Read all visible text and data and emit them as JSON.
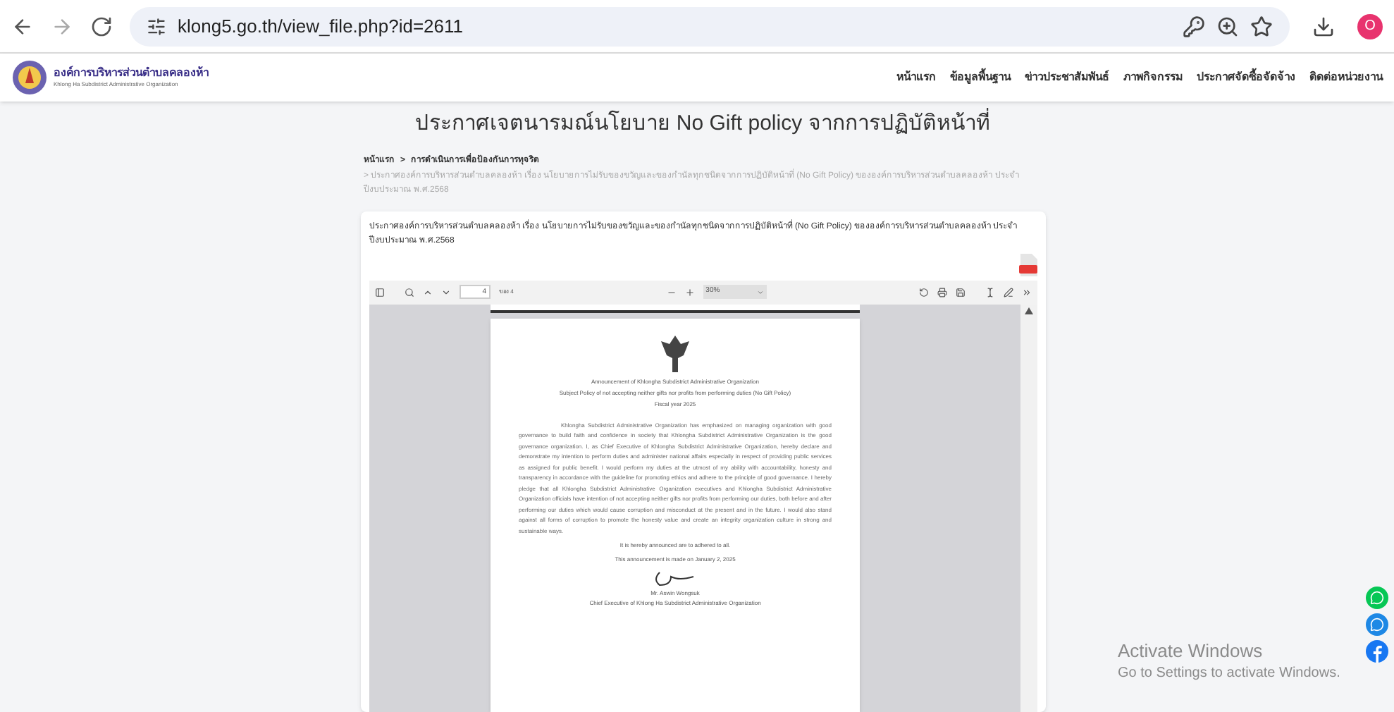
{
  "browser": {
    "url": "klong5.go.th/view_file.php?id=2611",
    "profile_initial": "O"
  },
  "site": {
    "name": "องค์การบริหารส่วนตำบลคลองห้า",
    "subtitle": "Khlong Ha Subdistrict Administrative Organization",
    "nav": [
      "หน้าแรก",
      "ข้อมูลพื้นฐาน",
      "ข่าวประชาสัมพันธ์",
      "ภาพกิจกรรม",
      "ประกาศจัดซื้อจัดจ้าง",
      "ติดต่อหน่วยงาน"
    ]
  },
  "page": {
    "title": "ประกาศเจตนารมณ์นโยบาย No Gift policy จากการปฏิบัติหน้าที่",
    "breadcrumb": [
      "หน้าแรก",
      "การดำเนินการเพื่อป้องกันการทุจริต"
    ],
    "breadcrumb_separator": ">",
    "breadcrumb_current": "> ประกาศองค์การบริหารส่วนตำบลคลองห้า เรื่อง นโยบายการไม่รับของขวัญและของกำนัลทุกชนิดจากการปฏิบัติหน้าที่ (No Gift Policy) ขององค์การบริหารส่วนตำบลคลองห้า ประจำปีงบประมาณ พ.ศ.2568",
    "file_title": "ประกาศองค์การบริหารส่วนตำบลคลองห้า เรื่อง นโยบายการไม่รับของขวัญและของกำนัลทุกชนิดจากการปฏิบัติหน้าที่ (No Gift Policy) ขององค์การบริหารส่วนตำบลคลองห้า ประจำปีงบประมาณ พ.ศ.2568"
  },
  "pdf_viewer": {
    "page_number": "4",
    "page_count": "ของ 4",
    "zoom": "30%",
    "document": {
      "heading": [
        "Announcement of Khlongha Subdistrict Administrative Organization",
        "Subject Policy of not accepting neither gifts nor profits from performing duties (No Gift Policy)",
        "Fiscal year 2025"
      ],
      "body": "Khlongha Subdistrict Administrative Organization has emphasized on managing organization with good governance to build faith and confidence in society that Khlongha Subdistrict Administrative Organization is the good governance organization. I, as Chief Executive of Khlongha Subdistrict Administrative Organization, hereby declare and demonstrate my intention to perform duties and administer national affairs especially in respect of providing public services as assigned for public benefit. I would perform my duties at the utmost of my ability with accountability, honesty and transparency in accordance with the guideline for promoting ethics and adhere to the principle of good governance. I hereby pledge that all Khlongha Subdistrict Administrative Organization executives and Khlongha Subdistrict Administrative Organization officials have intention of not accepting neither gifts nor profits from performing our duties, both before and after performing our duties which would cause corruption and misconduct at the present and in the future. I would also stand against all forms of corruption to promote the honesty value and create an integrity organization culture in strong and sustainable ways.",
      "closing": [
        "It is hereby announced are to adhered to all.",
        "This announcement is made on January 2, 2025"
      ],
      "signer": [
        "Mr. Aswin Wongsuk",
        "Chief Executive of Khlong Ha Subdistrict Administrative Organization"
      ]
    }
  },
  "os_notice": {
    "title": "Activate Windows",
    "message": "Go to Settings to activate Windows."
  }
}
